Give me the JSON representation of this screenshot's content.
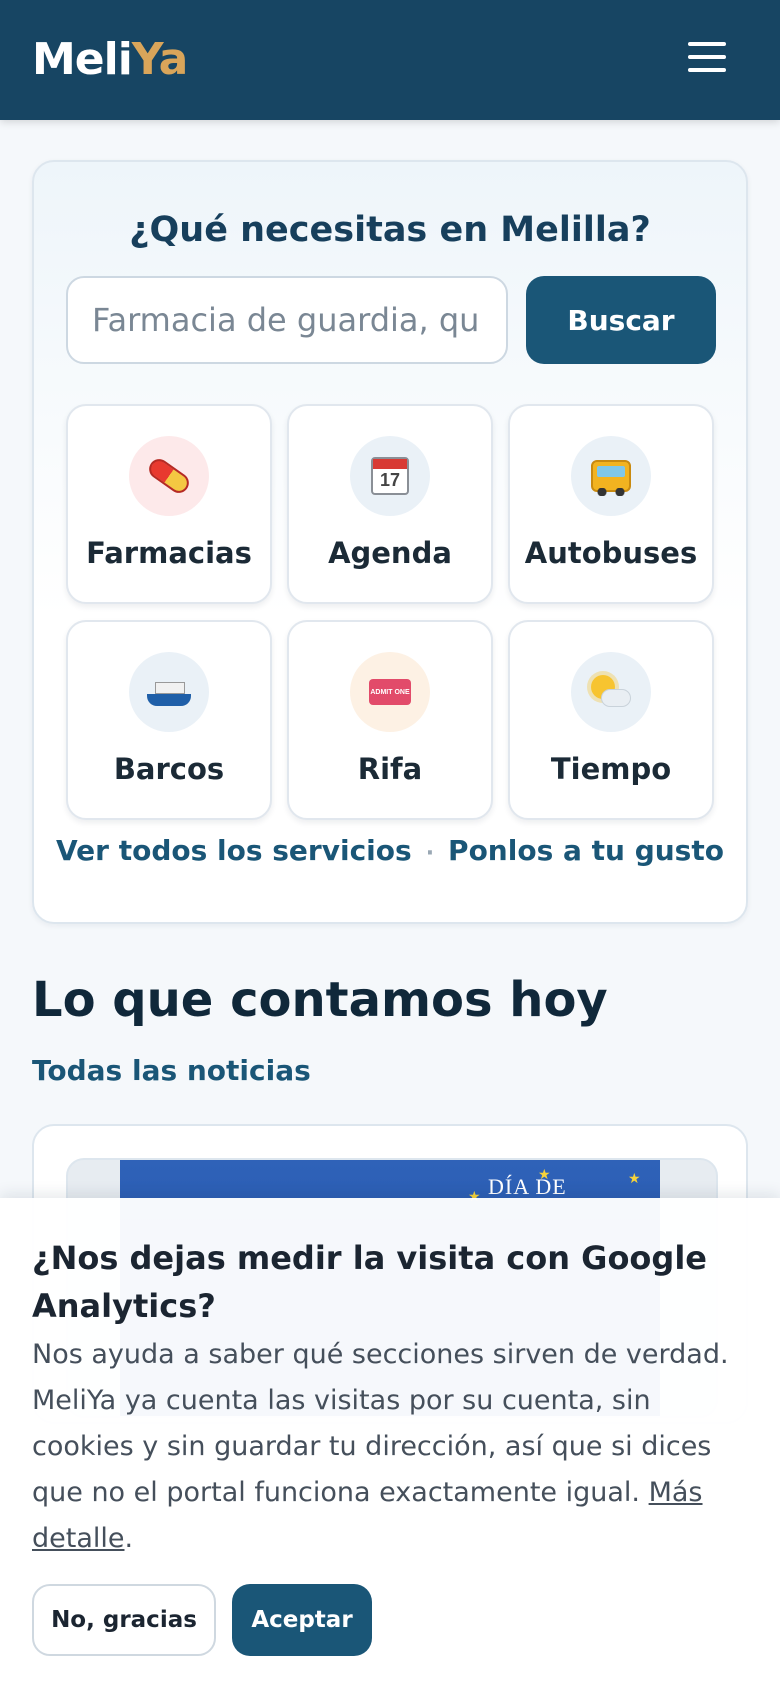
{
  "header": {
    "logo_part1": "Meli",
    "logo_part2": "Ya",
    "menu_icon": "hamburger-menu-icon",
    "brand_color": "#174563",
    "accent_color": "#d9a55a"
  },
  "search": {
    "title": "¿Qué necesitas en Melilla?",
    "placeholder": "Farmacia de guardia, qu",
    "button_label": "Buscar"
  },
  "services": [
    {
      "label": "Farmacias",
      "icon": "pill-icon"
    },
    {
      "label": "Agenda",
      "icon": "calendar-icon",
      "icon_text": "17"
    },
    {
      "label": "Autobuses",
      "icon": "bus-icon"
    },
    {
      "label": "Barcos",
      "icon": "ship-icon"
    },
    {
      "label": "Rifa",
      "icon": "ticket-icon",
      "icon_text": "ADMIT ONE"
    },
    {
      "label": "Tiempo",
      "icon": "sun-cloud-icon"
    }
  ],
  "service_links": {
    "all_services": "Ver todos los servicios",
    "separator": "·",
    "customize": "Ponlos a tu gusto"
  },
  "news": {
    "title": "Lo que contamos hoy",
    "all_link": "Todas las noticias",
    "image_text": "DÍA DE"
  },
  "cookie_banner": {
    "title": "¿Nos dejas medir la visita con Google Analytics?",
    "text": "Nos ayuda a saber qué secciones sirven de verdad. MeliYa ya cuenta las visitas por su cuenta, sin cookies y sin guardar tu dirección, así que si dices que no el portal funciona exactamente igual.",
    "more_link": "Más detalle",
    "more_suffix": ".",
    "decline_label": "No, gracias",
    "accept_label": "Aceptar"
  }
}
